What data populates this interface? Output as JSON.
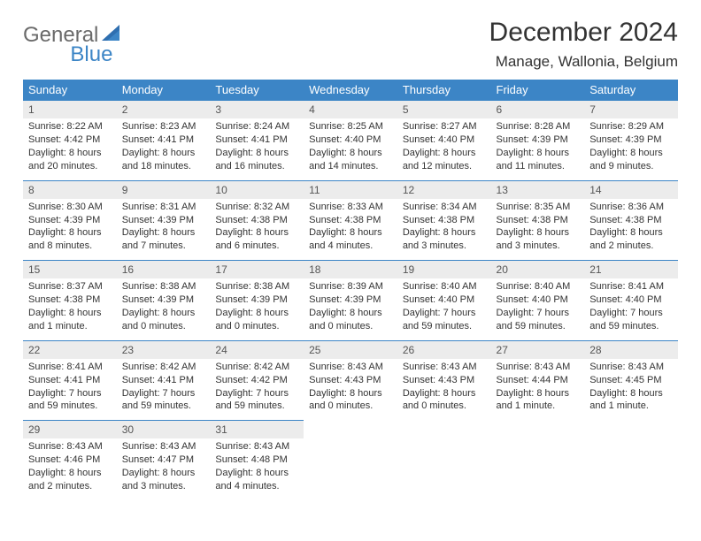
{
  "logo": {
    "word1": "General",
    "word2": "Blue"
  },
  "title": "December 2024",
  "location": "Manage, Wallonia, Belgium",
  "weekdays": [
    "Sunday",
    "Monday",
    "Tuesday",
    "Wednesday",
    "Thursday",
    "Friday",
    "Saturday"
  ],
  "weeks": [
    [
      {
        "n": "1",
        "sr": "Sunrise: 8:22 AM",
        "ss": "Sunset: 4:42 PM",
        "d1": "Daylight: 8 hours",
        "d2": "and 20 minutes."
      },
      {
        "n": "2",
        "sr": "Sunrise: 8:23 AM",
        "ss": "Sunset: 4:41 PM",
        "d1": "Daylight: 8 hours",
        "d2": "and 18 minutes."
      },
      {
        "n": "3",
        "sr": "Sunrise: 8:24 AM",
        "ss": "Sunset: 4:41 PM",
        "d1": "Daylight: 8 hours",
        "d2": "and 16 minutes."
      },
      {
        "n": "4",
        "sr": "Sunrise: 8:25 AM",
        "ss": "Sunset: 4:40 PM",
        "d1": "Daylight: 8 hours",
        "d2": "and 14 minutes."
      },
      {
        "n": "5",
        "sr": "Sunrise: 8:27 AM",
        "ss": "Sunset: 4:40 PM",
        "d1": "Daylight: 8 hours",
        "d2": "and 12 minutes."
      },
      {
        "n": "6",
        "sr": "Sunrise: 8:28 AM",
        "ss": "Sunset: 4:39 PM",
        "d1": "Daylight: 8 hours",
        "d2": "and 11 minutes."
      },
      {
        "n": "7",
        "sr": "Sunrise: 8:29 AM",
        "ss": "Sunset: 4:39 PM",
        "d1": "Daylight: 8 hours",
        "d2": "and 9 minutes."
      }
    ],
    [
      {
        "n": "8",
        "sr": "Sunrise: 8:30 AM",
        "ss": "Sunset: 4:39 PM",
        "d1": "Daylight: 8 hours",
        "d2": "and 8 minutes."
      },
      {
        "n": "9",
        "sr": "Sunrise: 8:31 AM",
        "ss": "Sunset: 4:39 PM",
        "d1": "Daylight: 8 hours",
        "d2": "and 7 minutes."
      },
      {
        "n": "10",
        "sr": "Sunrise: 8:32 AM",
        "ss": "Sunset: 4:38 PM",
        "d1": "Daylight: 8 hours",
        "d2": "and 6 minutes."
      },
      {
        "n": "11",
        "sr": "Sunrise: 8:33 AM",
        "ss": "Sunset: 4:38 PM",
        "d1": "Daylight: 8 hours",
        "d2": "and 4 minutes."
      },
      {
        "n": "12",
        "sr": "Sunrise: 8:34 AM",
        "ss": "Sunset: 4:38 PM",
        "d1": "Daylight: 8 hours",
        "d2": "and 3 minutes."
      },
      {
        "n": "13",
        "sr": "Sunrise: 8:35 AM",
        "ss": "Sunset: 4:38 PM",
        "d1": "Daylight: 8 hours",
        "d2": "and 3 minutes."
      },
      {
        "n": "14",
        "sr": "Sunrise: 8:36 AM",
        "ss": "Sunset: 4:38 PM",
        "d1": "Daylight: 8 hours",
        "d2": "and 2 minutes."
      }
    ],
    [
      {
        "n": "15",
        "sr": "Sunrise: 8:37 AM",
        "ss": "Sunset: 4:38 PM",
        "d1": "Daylight: 8 hours",
        "d2": "and 1 minute."
      },
      {
        "n": "16",
        "sr": "Sunrise: 8:38 AM",
        "ss": "Sunset: 4:39 PM",
        "d1": "Daylight: 8 hours",
        "d2": "and 0 minutes."
      },
      {
        "n": "17",
        "sr": "Sunrise: 8:38 AM",
        "ss": "Sunset: 4:39 PM",
        "d1": "Daylight: 8 hours",
        "d2": "and 0 minutes."
      },
      {
        "n": "18",
        "sr": "Sunrise: 8:39 AM",
        "ss": "Sunset: 4:39 PM",
        "d1": "Daylight: 8 hours",
        "d2": "and 0 minutes."
      },
      {
        "n": "19",
        "sr": "Sunrise: 8:40 AM",
        "ss": "Sunset: 4:40 PM",
        "d1": "Daylight: 7 hours",
        "d2": "and 59 minutes."
      },
      {
        "n": "20",
        "sr": "Sunrise: 8:40 AM",
        "ss": "Sunset: 4:40 PM",
        "d1": "Daylight: 7 hours",
        "d2": "and 59 minutes."
      },
      {
        "n": "21",
        "sr": "Sunrise: 8:41 AM",
        "ss": "Sunset: 4:40 PM",
        "d1": "Daylight: 7 hours",
        "d2": "and 59 minutes."
      }
    ],
    [
      {
        "n": "22",
        "sr": "Sunrise: 8:41 AM",
        "ss": "Sunset: 4:41 PM",
        "d1": "Daylight: 7 hours",
        "d2": "and 59 minutes."
      },
      {
        "n": "23",
        "sr": "Sunrise: 8:42 AM",
        "ss": "Sunset: 4:41 PM",
        "d1": "Daylight: 7 hours",
        "d2": "and 59 minutes."
      },
      {
        "n": "24",
        "sr": "Sunrise: 8:42 AM",
        "ss": "Sunset: 4:42 PM",
        "d1": "Daylight: 7 hours",
        "d2": "and 59 minutes."
      },
      {
        "n": "25",
        "sr": "Sunrise: 8:43 AM",
        "ss": "Sunset: 4:43 PM",
        "d1": "Daylight: 8 hours",
        "d2": "and 0 minutes."
      },
      {
        "n": "26",
        "sr": "Sunrise: 8:43 AM",
        "ss": "Sunset: 4:43 PM",
        "d1": "Daylight: 8 hours",
        "d2": "and 0 minutes."
      },
      {
        "n": "27",
        "sr": "Sunrise: 8:43 AM",
        "ss": "Sunset: 4:44 PM",
        "d1": "Daylight: 8 hours",
        "d2": "and 1 minute."
      },
      {
        "n": "28",
        "sr": "Sunrise: 8:43 AM",
        "ss": "Sunset: 4:45 PM",
        "d1": "Daylight: 8 hours",
        "d2": "and 1 minute."
      }
    ],
    [
      {
        "n": "29",
        "sr": "Sunrise: 8:43 AM",
        "ss": "Sunset: 4:46 PM",
        "d1": "Daylight: 8 hours",
        "d2": "and 2 minutes."
      },
      {
        "n": "30",
        "sr": "Sunrise: 8:43 AM",
        "ss": "Sunset: 4:47 PM",
        "d1": "Daylight: 8 hours",
        "d2": "and 3 minutes."
      },
      {
        "n": "31",
        "sr": "Sunrise: 8:43 AM",
        "ss": "Sunset: 4:48 PM",
        "d1": "Daylight: 8 hours",
        "d2": "and 4 minutes."
      },
      null,
      null,
      null,
      null
    ]
  ]
}
